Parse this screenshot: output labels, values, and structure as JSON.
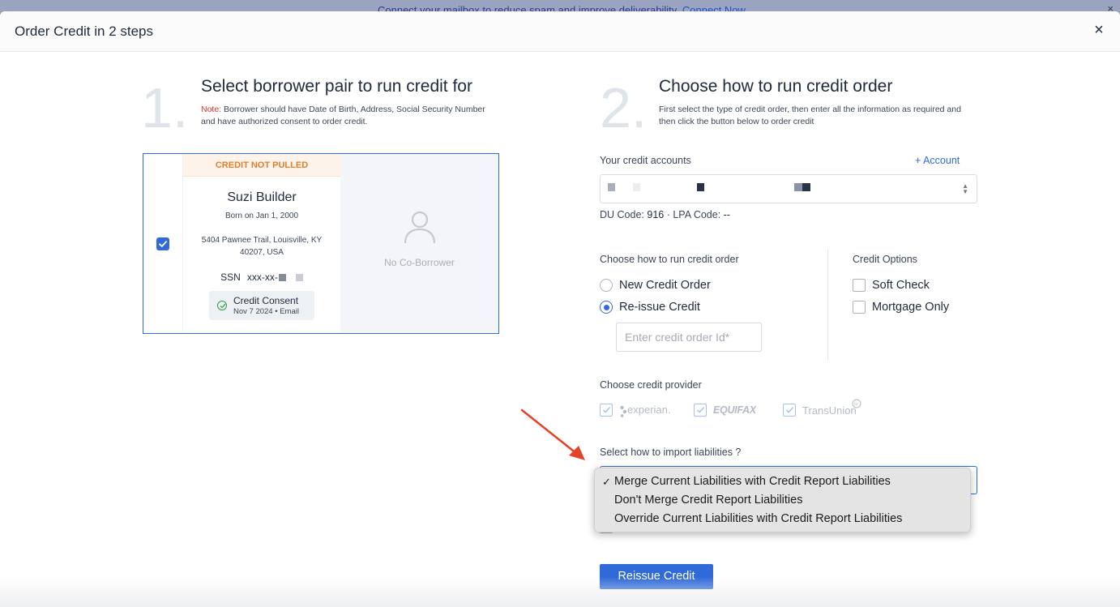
{
  "banner": {
    "text": "Connect your mailbox to reduce spam and improve deliverability.",
    "link": "Connect Now",
    "close_icon": "×"
  },
  "modal": {
    "title": "Order Credit in 2 steps",
    "close_icon": "×"
  },
  "step1": {
    "number": "1.",
    "title": "Select borrower pair to run credit for",
    "note_label": "Note:",
    "note_text": " Borrower should have Date of Birth, Address, Social Security Number and have authorized consent to order credit."
  },
  "borrower": {
    "status": "CREDIT NOT PULLED",
    "name": "Suzi Builder",
    "born": "Born on Jan 1, 2000",
    "address": "5404 Pawnee Trail, Louisville, KY 40207, USA",
    "ssn_label": "SSN",
    "ssn_value": "xxx-xx-",
    "consent_title": "Credit Consent",
    "consent_sub": "Nov 7 2024 • Email",
    "selected": true
  },
  "coborrower": {
    "text": "No Co-Borrower",
    "icon": "person-outline-icon"
  },
  "step2": {
    "number": "2.",
    "title": "Choose how to run credit order",
    "desc": "First select the type of credit order, then enter all the information as required and then click the button below to order credit"
  },
  "accounts": {
    "label": "Your credit accounts",
    "add_label": "+ Account",
    "du_label": "DU Code:",
    "du_value": "916",
    "lpa_label": "LPA Code:",
    "lpa_value": "--"
  },
  "order_type": {
    "label": "Choose how to run credit order",
    "options": [
      "New Credit Order",
      "Re-issue Credit"
    ],
    "selected_index": 1,
    "input_placeholder": "Enter credit order Id*"
  },
  "credit_options": {
    "label": "Credit Options",
    "options": [
      "Soft Check",
      "Mortgage Only"
    ]
  },
  "providers": {
    "label": "Choose credit provider",
    "items": [
      "experian.",
      "EQUIFAX",
      "TransUnion"
    ]
  },
  "liabilities": {
    "label": "Select how to import liabilities ?",
    "options": [
      "Merge Current Liabilities with Credit Report Liabilities",
      "Don't Merge Credit Report Liabilities",
      "Override Current Liabilities with Credit Report Liabilities"
    ],
    "selected_index": 0,
    "check_mark": "✓"
  },
  "submit": {
    "label": "Reissue Credit"
  },
  "colors": {
    "accent": "#2f6ad8",
    "warning": "#e07f2f",
    "note": "#d9342b",
    "annotation_arrow": "#e4452a"
  }
}
